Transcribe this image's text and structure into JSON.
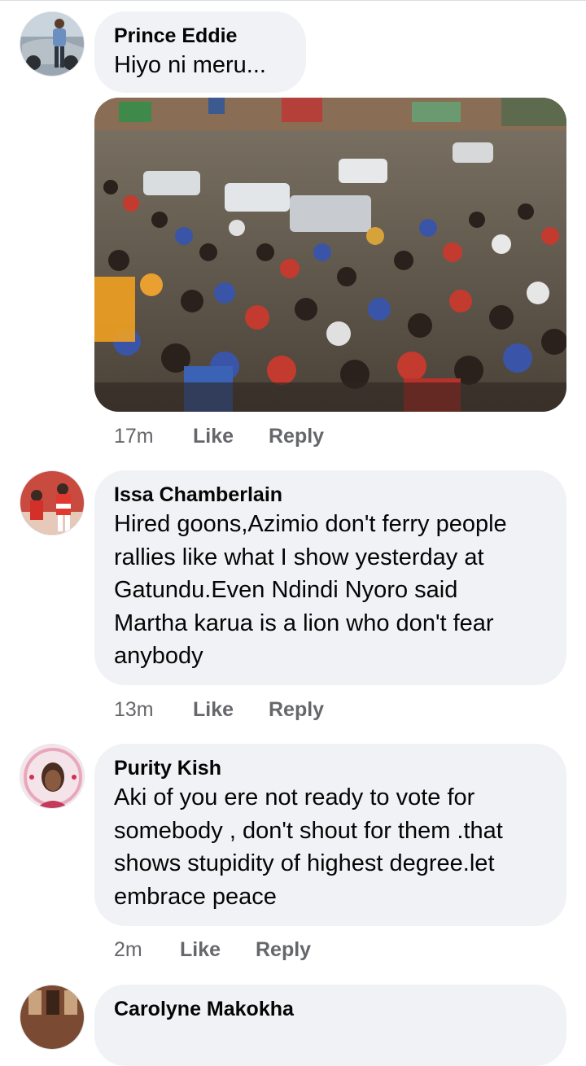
{
  "comments": [
    {
      "author": "Prince Eddie",
      "text": "Hiyo ni meru...",
      "time": "17m",
      "like": "Like",
      "reply": "Reply",
      "has_photo": true
    },
    {
      "author": "Issa Chamberlain",
      "lines": [
        "Hired goons,Azimio don't ferry people",
        "rallies like what I show yesterday at",
        "Gatundu.Even Ndindi Nyoro said",
        "Martha karua is a lion who don't fear",
        "anybody"
      ],
      "time": "13m",
      "like": "Like",
      "reply": "Reply"
    },
    {
      "author": "Purity Kish",
      "lines": [
        "Aki of you ere not ready to vote for",
        "somebody , don't shout for them .that",
        "shows stupidity of highest degree.let",
        "embrace peace"
      ],
      "time": "2m",
      "like": "Like",
      "reply": "Reply"
    },
    {
      "author": "Carolyne Makokha"
    }
  ],
  "colors": {
    "bubble": "#f0f2f5",
    "meta": "#65676b",
    "text": "#050505"
  }
}
